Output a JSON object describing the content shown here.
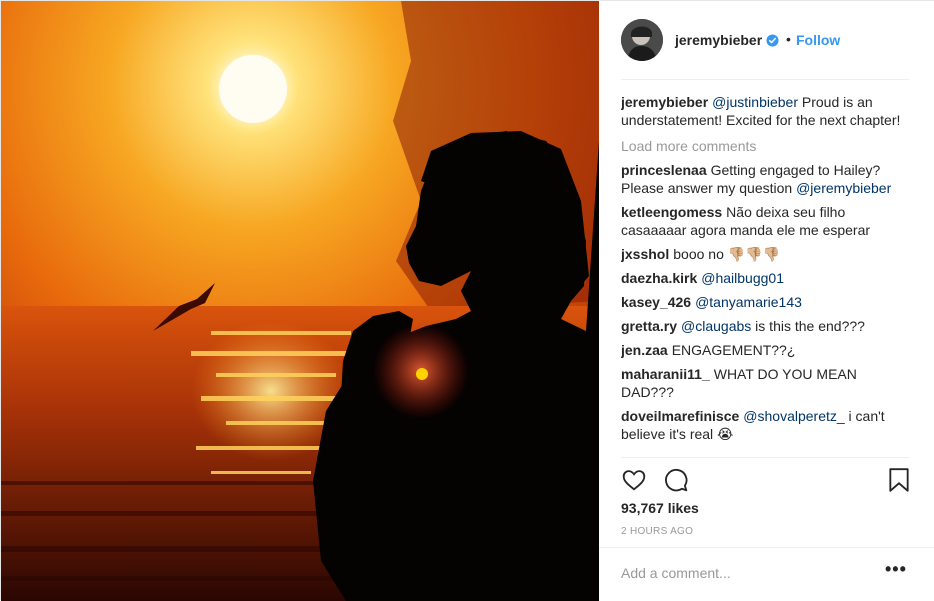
{
  "header": {
    "username": "jeremybieber",
    "separator": "•",
    "follow_label": "Follow"
  },
  "caption": {
    "username": "jeremybieber",
    "mention": "@justinbieber",
    "text": " Proud is an understatement! Excited for the next chapter!"
  },
  "load_more_label": "Load more comments",
  "comments": [
    {
      "username": "princeslenaa",
      "parts": [
        {
          "t": "Getting engaged to Hailey? Please answer my question "
        },
        {
          "m": "@jeremybieber"
        }
      ]
    },
    {
      "username": "ketleengomess",
      "parts": [
        {
          "t": "Não deixa seu filho casaaaaar agora manda ele me esperar"
        }
      ]
    },
    {
      "username": "jxsshol",
      "parts": [
        {
          "t": "booo no 👎🏼👎🏼👎🏼"
        }
      ]
    },
    {
      "username": "daezha.kirk",
      "parts": [
        {
          "m": "@hailbugg01"
        }
      ]
    },
    {
      "username": "kasey_426",
      "parts": [
        {
          "m": "@tanyamarie143"
        }
      ]
    },
    {
      "username": "gretta.ry",
      "parts": [
        {
          "m": "@claugabs"
        },
        {
          "t": " is this the end???"
        }
      ]
    },
    {
      "username": "jen.zaa",
      "parts": [
        {
          "t": "ENGAGEMENT??¿"
        }
      ]
    },
    {
      "username": "maharanii11_",
      "parts": [
        {
          "t": "WHAT DO YOU MEAN DAD???"
        }
      ]
    },
    {
      "username": "doveilmarefinisce",
      "parts": [
        {
          "m": "@shovalperetz_"
        },
        {
          "t": " i can't believe it's real 😭"
        }
      ]
    }
  ],
  "likes_label": "93,767 likes",
  "timestamp": "2 HOURS AGO",
  "add_comment_placeholder": "Add a comment...",
  "more_label": "•••",
  "icons": {
    "verified": "verified-badge-icon",
    "like": "heart-outline-icon",
    "comment": "speech-bubble-icon",
    "save": "bookmark-icon",
    "more": "ellipsis-icon"
  },
  "colors": {
    "link": "#3897f0",
    "mention": "#003569",
    "muted": "#999999",
    "text": "#262626"
  }
}
